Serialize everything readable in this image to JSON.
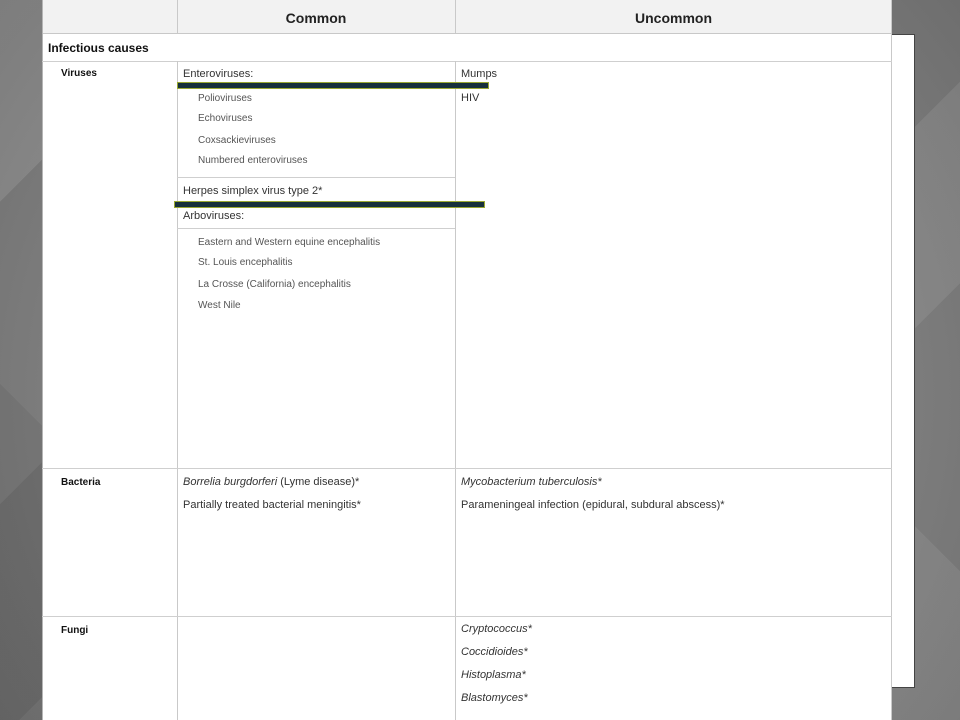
{
  "table": {
    "headers": {
      "common": "Common",
      "uncommon": "Uncommon"
    },
    "section_title": "Infectious causes",
    "rows": {
      "viruses": {
        "label": "Viruses",
        "common": {
          "enteroviruses": "Enteroviruses:",
          "enterovirus_list": [
            "Polioviruses",
            "Echoviruses",
            "Coxsackieviruses",
            "Numbered enteroviruses"
          ],
          "hsv": "Herpes simplex virus type 2*",
          "arboviruses": "Arboviruses:",
          "arbovirus_list": [
            "Eastern and Western equine encephalitis",
            "St. Louis encephalitis",
            "La Crosse (California) encephalitis",
            "West Nile"
          ]
        },
        "uncommon": [
          "Mumps",
          "HIV"
        ]
      },
      "bacteria": {
        "label": "Bacteria",
        "common": {
          "borrelia": "Borrelia burgdorferi",
          "borrelia_note": " (Lyme disease)*",
          "partial": "Partially treated bacterial meningitis*"
        },
        "uncommon": {
          "mtb": "Mycobacterium tuberculosis*",
          "parameningeal": "Parameningeal infection (epidural, subdural abscess)*"
        }
      },
      "fungi": {
        "label": "Fungi",
        "uncommon": [
          "Cryptococcus*",
          "Coccidioides*",
          "Histoplasma*",
          "Blastomyces*"
        ]
      }
    }
  },
  "colors": {
    "highlight_bar": "#17303a",
    "highlight_border": "#9aa832",
    "background": "#8a8a8a"
  }
}
